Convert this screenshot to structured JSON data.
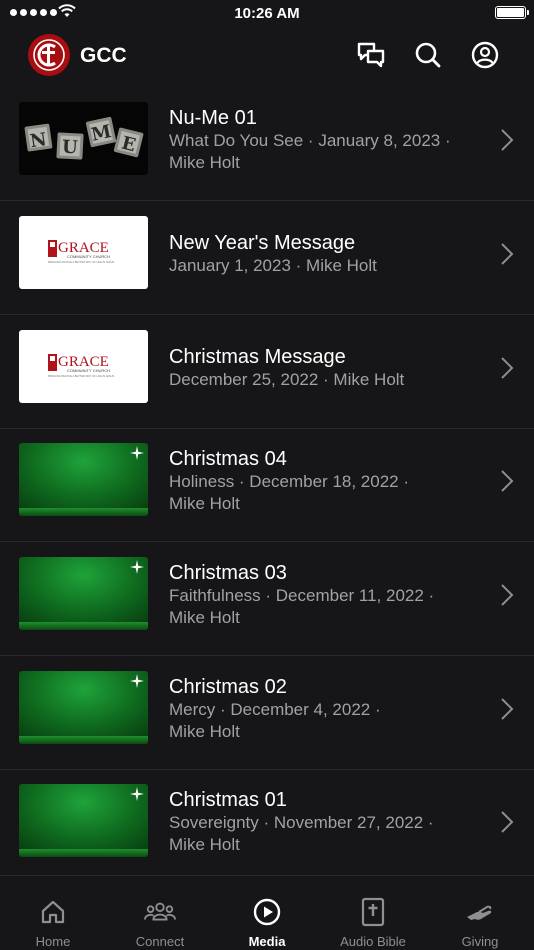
{
  "status_bar": {
    "time": "10:26 AM",
    "signal_bars": 5,
    "battery_level": 1.0
  },
  "header": {
    "title": "GCC",
    "logo_text": "C",
    "icons": [
      "chat-icon",
      "search-icon",
      "account-icon"
    ]
  },
  "media": [
    {
      "thumb": "nume",
      "title": "Nu-Me 01",
      "line1": "What Do You See · January 8, 2023 ·",
      "line2": "Mike Holt"
    },
    {
      "thumb": "grace",
      "title": "New Year's Message",
      "line1": "January 1, 2023 · Mike Holt",
      "line2": ""
    },
    {
      "thumb": "grace",
      "title": "Christmas Message",
      "line1": "December 25, 2022 · Mike Holt",
      "line2": ""
    },
    {
      "thumb": "green",
      "title": "Christmas 04",
      "line1": "Holiness · December 18, 2022 ·",
      "line2": "Mike Holt"
    },
    {
      "thumb": "green",
      "title": "Christmas 03",
      "line1": "Faithfulness · December 11, 2022 ·",
      "line2": "Mike Holt"
    },
    {
      "thumb": "green",
      "title": "Christmas 02",
      "line1": "Mercy · December 4, 2022 ·",
      "line2": "Mike Holt"
    },
    {
      "thumb": "green",
      "title": "Christmas 01",
      "line1": "Sovereignty · November 27, 2022 ·",
      "line2": "Mike Holt"
    }
  ],
  "thumbs": {
    "nume_letters": [
      "N",
      "U",
      "M",
      "E"
    ],
    "grace_name": "GRACE",
    "grace_sub": "COMMUNITY CHURCH",
    "grace_tagline": "BRINGING PEOPLE A BETTER WAY OF LIFE IN JESUS"
  },
  "tabs": [
    {
      "label": "Home",
      "icon": "home-icon",
      "active": false
    },
    {
      "label": "Connect",
      "icon": "people-icon",
      "active": false
    },
    {
      "label": "Media",
      "icon": "play-icon",
      "active": true
    },
    {
      "label": "Audio Bible",
      "icon": "bible-icon",
      "active": false
    },
    {
      "label": "Giving",
      "icon": "giving-icon",
      "active": false
    }
  ],
  "colors": {
    "background": "#161618",
    "brand": "#a80d12",
    "secondary_text": "#a1a1a6",
    "inactive_tab": "#8e8e93"
  }
}
